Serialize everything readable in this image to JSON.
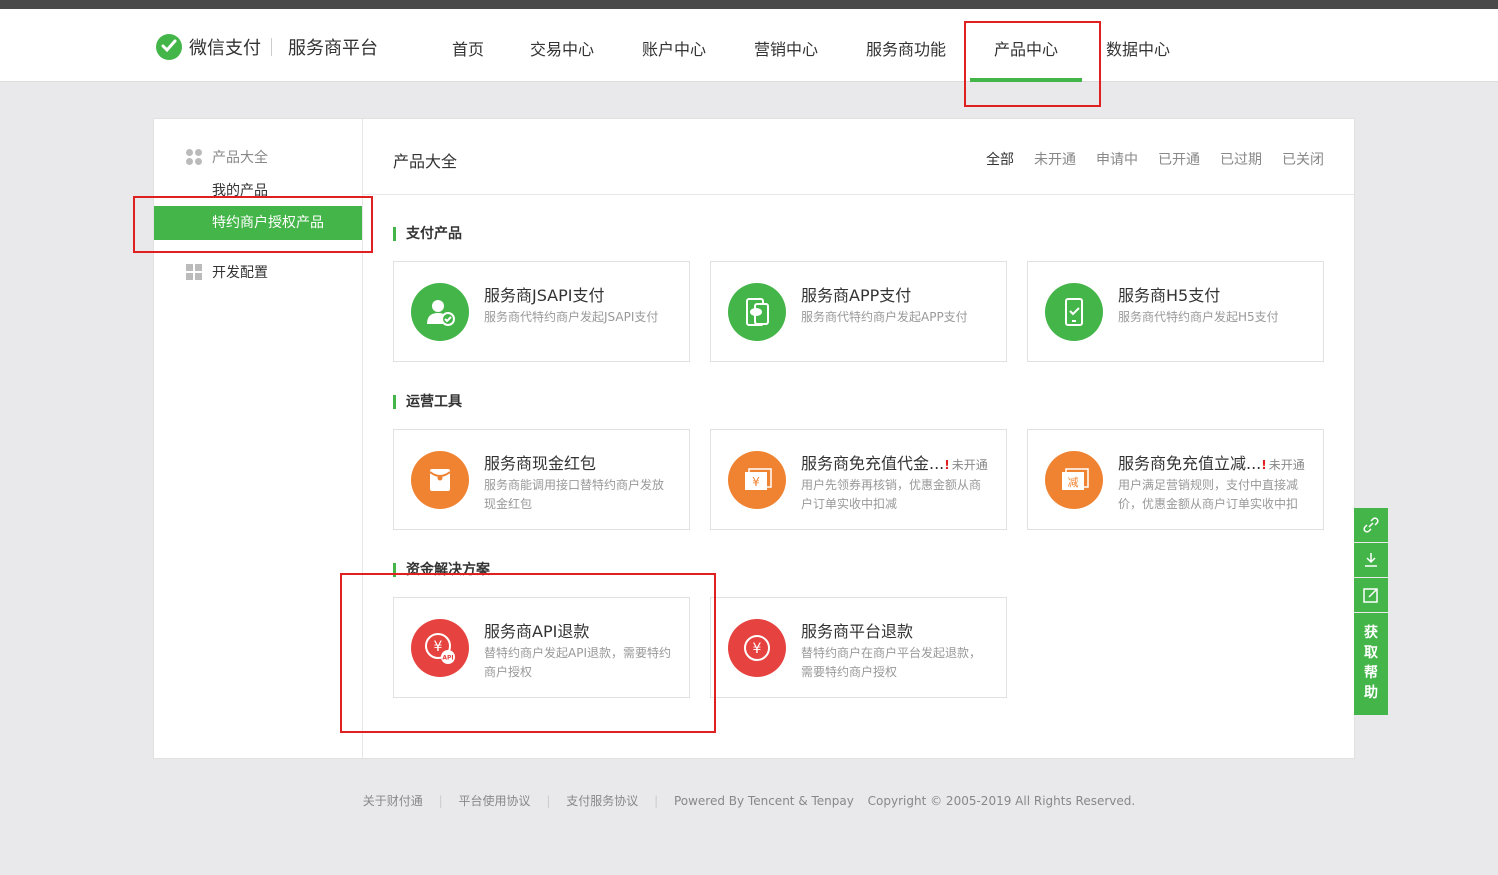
{
  "header": {
    "brand": "微信支付",
    "platform": "服务商平台",
    "nav": [
      {
        "label": "首页"
      },
      {
        "label": "交易中心"
      },
      {
        "label": "账户中心"
      },
      {
        "label": "营销中心"
      },
      {
        "label": "服务商功能"
      },
      {
        "label": "产品中心"
      },
      {
        "label": "数据中心"
      }
    ],
    "active_nav": "产品中心"
  },
  "sidebar": {
    "group_products": "产品大全",
    "my_products": "我的产品",
    "authorized_products": "特约商户授权产品",
    "group_dev": "开发配置"
  },
  "content": {
    "title": "产品大全",
    "filters": [
      "全部",
      "未开通",
      "申请中",
      "已开通",
      "已过期",
      "已关闭"
    ],
    "sections": [
      {
        "title": "支付产品",
        "cards": [
          {
            "name": "服务商JSAPI支付",
            "desc": "服务商代特约商户发起JSAPI支付",
            "icon": "user-check-icon"
          },
          {
            "name": "服务商APP支付",
            "desc": "服务商代特约商户发起APP支付",
            "icon": "app-pay-icon"
          },
          {
            "name": "服务商H5支付",
            "desc": "服务商代特约商户发起H5支付",
            "icon": "phone-check-icon"
          }
        ]
      },
      {
        "title": "运营工具",
        "cards": [
          {
            "name": "服务商现金红包",
            "desc": "服务商能调用接口替特约商户发放现金红包",
            "icon": "red-packet-icon"
          },
          {
            "name": "服务商免充值代金...",
            "status": "未开通",
            "desc": "用户先领券再核销，优惠金额从商户订单实收中扣减",
            "icon": "voucher-icon"
          },
          {
            "name": "服务商免充值立减...",
            "status": "未开通",
            "desc": "用户满足营销规则，支付中直接减价，优惠金额从商户订单实收中扣",
            "icon": "discount-icon"
          }
        ]
      },
      {
        "title": "资金解决方案",
        "cards": [
          {
            "name": "服务商API退款",
            "desc": "替特约商户发起API退款，需要特约商户授权",
            "icon": "api-refund-icon"
          },
          {
            "name": "服务商平台退款",
            "desc": "替特约商户在商户平台发起退款，需要特约商户授权",
            "icon": "refund-icon"
          }
        ]
      }
    ]
  },
  "float_bar": {
    "help": "获取帮助",
    "help_chars": [
      "获",
      "取",
      "帮",
      "助"
    ]
  },
  "footer": {
    "links": [
      "关于财付通",
      "平台使用协议",
      "支付服务协议"
    ],
    "powered": "Powered By Tencent & Tenpay",
    "copyright": "Copyright © 2005-2019 All Rights Reserved."
  },
  "colors": {
    "accent": "#44b549",
    "orange": "#f08331",
    "red": "#e64340",
    "highlight": "#e02020"
  }
}
